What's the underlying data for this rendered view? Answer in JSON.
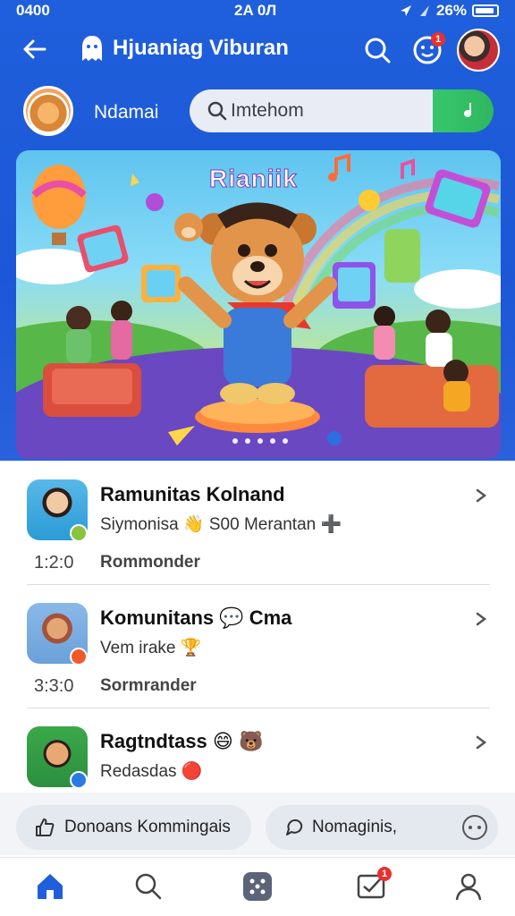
{
  "status_bar": {
    "time": "0400",
    "center": "2A 0Л",
    "battery": "26%"
  },
  "header": {
    "title": "Hjuaniag Viburan",
    "notification_count": "1"
  },
  "profile": {
    "name": "Ndamai",
    "search_placeholder": "Imtehom"
  },
  "banner": {
    "title": "Rianiik",
    "page_count": 5,
    "active_page": 1
  },
  "list": [
    {
      "name": "Ramunitas Kolnand",
      "subtitle": "Siymonisa 👋 S00 Merantan ➕",
      "time": "1:2:0",
      "status": "Rommonder",
      "avatar_color": "#2b9bd6",
      "badge_color": "#8ac43f"
    },
    {
      "name": "Komunitans 💬 Cma",
      "subtitle": "Vem irake 🏆",
      "time": "3:3:0",
      "status": "Sormrander",
      "avatar_color": "#6aa1d9",
      "badge_color": "#f05a28"
    },
    {
      "name": "Ragtndtass 😄 🐻",
      "subtitle": "Redasdas 🔴",
      "time": "",
      "status": "",
      "avatar_color": "#2d8f3f",
      "badge_color": "#2b7ae4"
    }
  ],
  "actions": {
    "like_label": "Donoans Kommingais",
    "comment_label": "Nomaginis,"
  },
  "tabbar": {
    "messages_badge": "1"
  },
  "colors": {
    "primary": "#1f5fdc",
    "accent_green": "#37c66b",
    "badge_red": "#e8312f"
  }
}
